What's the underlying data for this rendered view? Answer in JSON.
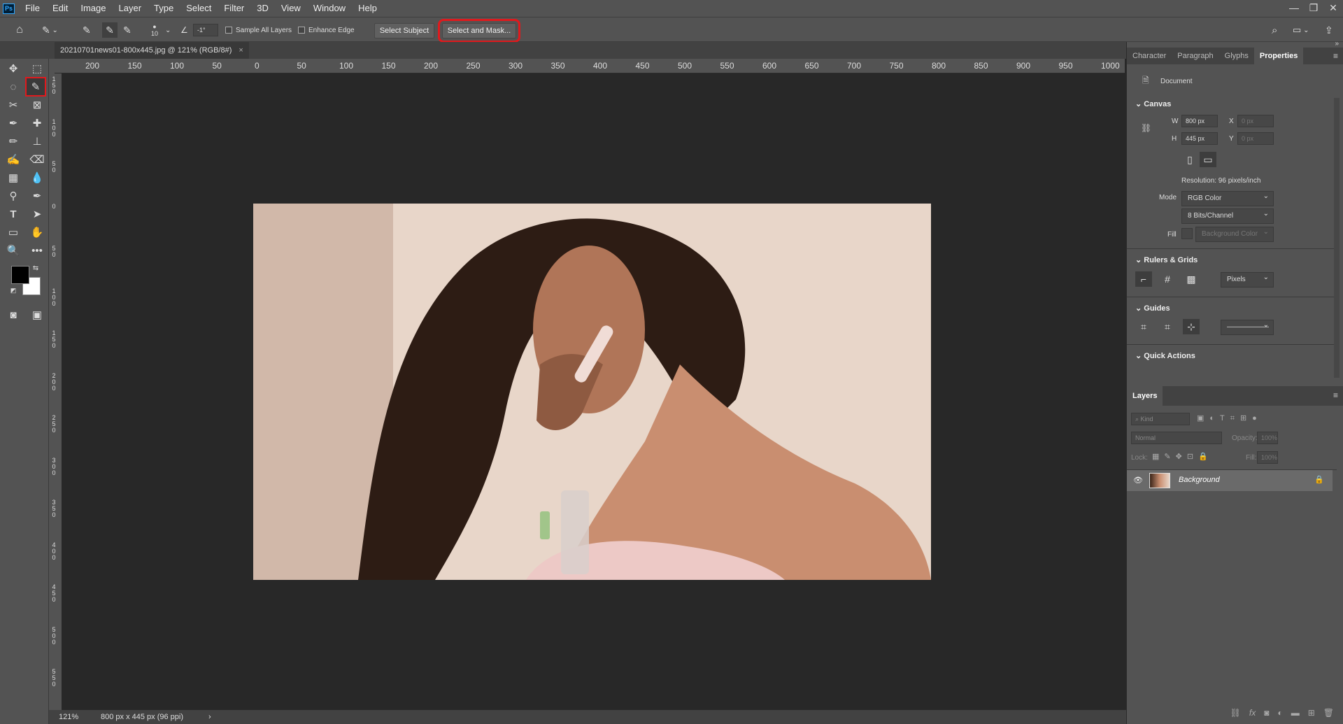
{
  "menubar": {
    "logo": "Ps",
    "items": [
      "File",
      "Edit",
      "Image",
      "Layer",
      "Type",
      "Select",
      "Filter",
      "3D",
      "View",
      "Window",
      "Help"
    ],
    "window_controls": [
      "—",
      "❐",
      "✕"
    ]
  },
  "options": {
    "brush_size": "10",
    "angle": "-1°",
    "sample_all_layers": "Sample All Layers",
    "enhance_edge": "Enhance Edge",
    "select_subject": "Select Subject",
    "select_and_mask": "Select and Mask..."
  },
  "document": {
    "tab_title": "20210701news01-800x445.jpg @ 121% (RGB/8#)",
    "close": "×"
  },
  "ruler": {
    "h_labels": [
      "200",
      "150",
      "100",
      "50",
      "0",
      "50",
      "100",
      "150",
      "200",
      "250",
      "300",
      "350",
      "400",
      "450",
      "500",
      "550",
      "600",
      "650",
      "700",
      "750",
      "800",
      "850",
      "900",
      "950",
      "1000"
    ],
    "v_labels": [
      "150",
      "100",
      "50",
      "0",
      "50",
      "100",
      "150",
      "200",
      "250",
      "300",
      "350",
      "400",
      "450",
      "500",
      "550"
    ]
  },
  "status": {
    "zoom": "121%",
    "doc_info": "800 px x 445 px (96 ppi)",
    "arrow": "›"
  },
  "panel": {
    "tabs": [
      "Character",
      "Paragraph",
      "Glyphs",
      "Properties"
    ],
    "document_label": "Document",
    "canvas": {
      "title": "Canvas",
      "w_label": "W",
      "w_value": "800 px",
      "h_label": "H",
      "h_value": "445 px",
      "x_label": "X",
      "x_value": "0 px",
      "y_label": "Y",
      "y_value": "0 px",
      "resolution": "Resolution: 96 pixels/inch",
      "mode_label": "Mode",
      "mode_value": "RGB Color",
      "bits_value": "8 Bits/Channel",
      "fill_label": "Fill",
      "fill_value": "Background Color"
    },
    "rulers_grids": {
      "title": "Rulers & Grids",
      "units": "Pixels"
    },
    "guides": {
      "title": "Guides",
      "style": "——————"
    },
    "quick_actions": {
      "title": "Quick Actions"
    }
  },
  "layers": {
    "title": "Layers",
    "kind_placeholder": "Kind",
    "blend_mode": "Normal",
    "opacity_label": "Opacity:",
    "opacity_value": "100%",
    "lock_label": "Lock:",
    "fill_label": "Fill:",
    "fill_value": "100%",
    "layer_name": "Background"
  },
  "colors": {
    "accent_highlight": "#e0191d",
    "foreground": "#000000",
    "background": "#ffffff"
  }
}
